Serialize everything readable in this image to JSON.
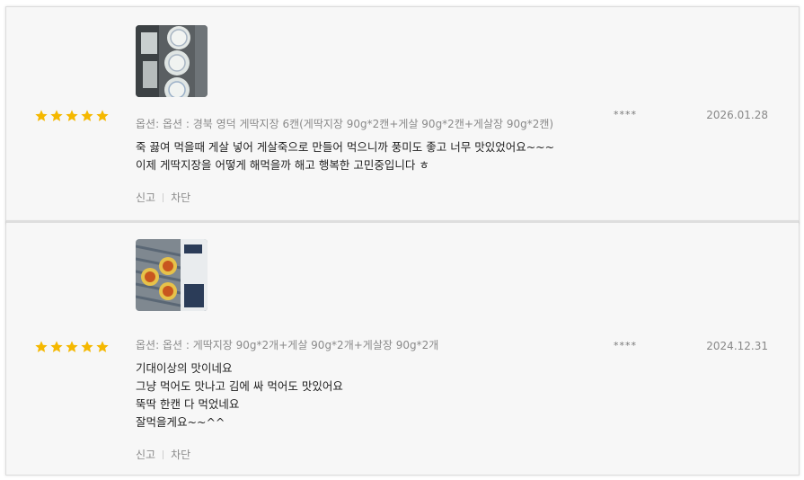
{
  "reviews": [
    {
      "rating": 5,
      "photo_icon": "review-photo",
      "option": "옵션: 옵션 : 경북 영덕 게딱지장 6캔(게딱지장 90g*2캔+게살 90g*2캔+게살장 90g*2캔)",
      "lines": [
        "죽 끓여 먹을때 게살 넣어 게살죽으로 만들어 먹으니까 풍미도 좋고 너무 맛있었어요~~~",
        "이제 게딱지장을 어떻게 해먹을까 해고 행복한 고민중입니다 ㅎ"
      ],
      "report_label": "신고",
      "block_label": "차단",
      "author": "****",
      "date": "2026.01.28"
    },
    {
      "rating": 5,
      "photo_icon": "review-photo",
      "option": "옵션: 옵션 : 게딱지장 90g*2개+게살 90g*2개+게살장 90g*2개",
      "lines": [
        "기대이상의 맛이네요",
        "그냥 먹어도 맛나고 김에 싸 먹어도 맛있어요",
        "뚝딱 한캔 다 먹었네요",
        "잘먹을게요~~^^"
      ],
      "report_label": "신고",
      "block_label": "차단",
      "author": "****",
      "date": "2024.12.31"
    }
  ],
  "colors": {
    "star": "#f5b800",
    "background": "#f7f7f7",
    "muted_text": "#8a8a8a"
  }
}
